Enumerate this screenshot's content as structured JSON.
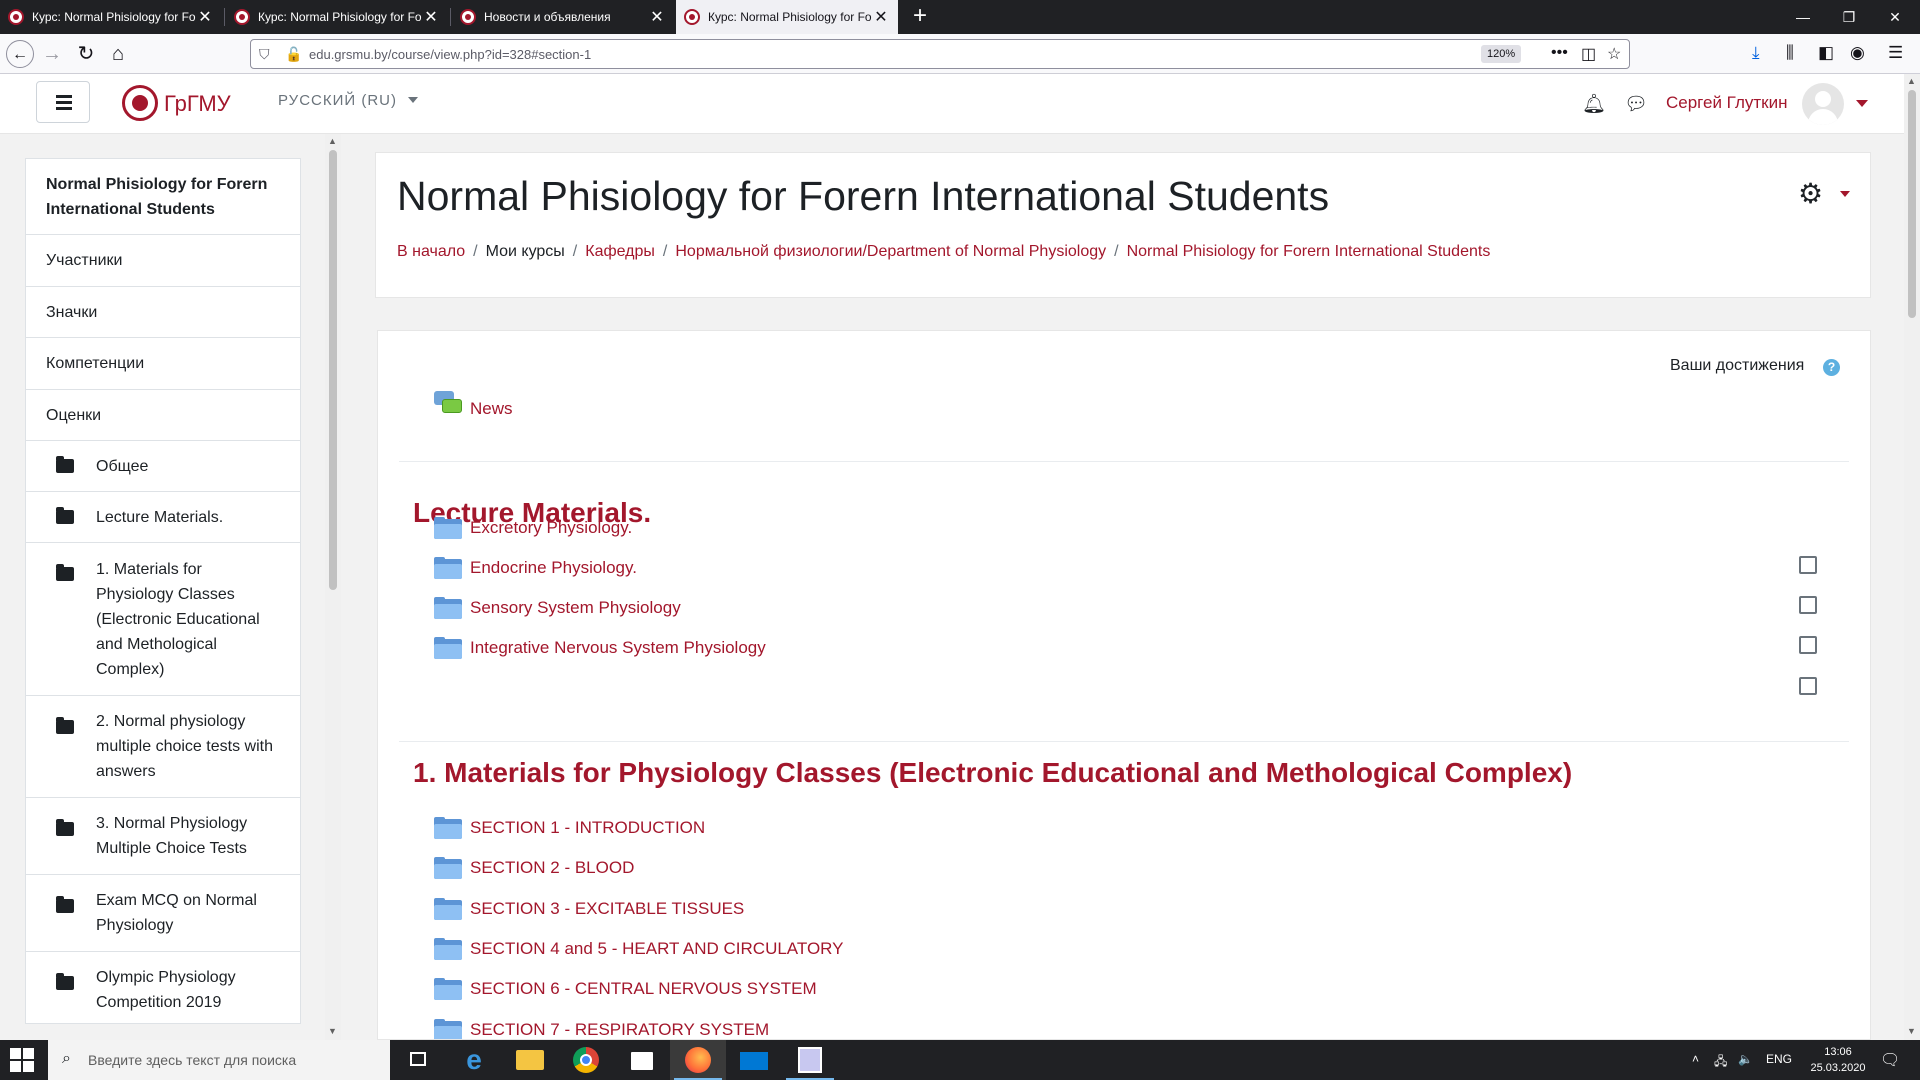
{
  "browser": {
    "tabs": [
      {
        "label": "Курс: Normal Phisiology for Forern International Students",
        "active": false
      },
      {
        "label": "Курс: Normal Phisiology for Forern International Students",
        "active": false
      },
      {
        "label": "Новости и объявления",
        "active": false
      },
      {
        "label": "Курс: Normal Phisiology for Forern International Students",
        "active": true
      }
    ],
    "url": "edu.grsmu.by/course/view.php?id=328#section-1",
    "zoom": "120%"
  },
  "header": {
    "site_name": "ГрГМУ",
    "language": "РУССКИЙ (RU)",
    "user_name": "Сергей Глуткин"
  },
  "drawer": {
    "course_title": "Normal Phisiology for Forern International Students",
    "links": [
      "Участники",
      "Значки",
      "Компетенции",
      "Оценки"
    ],
    "sections": [
      "Общее",
      "Lecture Materials.",
      "1. Materials for Physiology Classes (Electronic Educational and Methological Complex)",
      "2. Normal physiology multiple choice tests with answers",
      "3. Normal Physiology Multiple Choice Tests",
      "Exam MCQ on Normal Physiology",
      "Olympic Physiology Competition 2019"
    ]
  },
  "page": {
    "title": "Normal Phisiology for Forern International Students",
    "breadcrumb": [
      "В начало",
      "Мои курсы",
      "Кафедры",
      "Нормальной физиологии/Department of Normal Physiology",
      "Normal Phisiology for Forern International Students"
    ]
  },
  "content": {
    "achievements_label": "Ваши достижения",
    "help_glyph": "?",
    "news_label": "News",
    "lecture_section": {
      "title": "Lecture Materials.",
      "items": [
        "Excretory Physiology.",
        "Endocrine Physiology.",
        "Sensory System Physiology",
        "Integrative Nervous System Physiology"
      ]
    },
    "materials_section": {
      "title": "1. Materials for Physiology Classes (Electronic Educational and Methological Complex)",
      "items": [
        "SECTION 1 - INTRODUCTION",
        "SECTION 2 - BLOOD",
        "SECTION 3 - EXCITABLE TISSUES",
        "SECTION 4 and 5 - HEART AND CIRCULATORY",
        "SECTION 6 - CENTRAL NERVOUS SYSTEM",
        "SECTION 7 - RESPIRATORY SYSTEM"
      ]
    }
  },
  "taskbar": {
    "search_placeholder": "Введите здесь текст для поиска",
    "language": "ENG",
    "time": "13:06",
    "date": "25.03.2020"
  },
  "colors": {
    "brand": "#a3172c",
    "page_background": "#f2f2f2",
    "folder_icon": "#8ec0f3"
  },
  "icons": [
    "search-icon",
    "folder-icon",
    "bell-icon",
    "chat-icon",
    "gear-icon",
    "help-icon",
    "forum-icon"
  ]
}
